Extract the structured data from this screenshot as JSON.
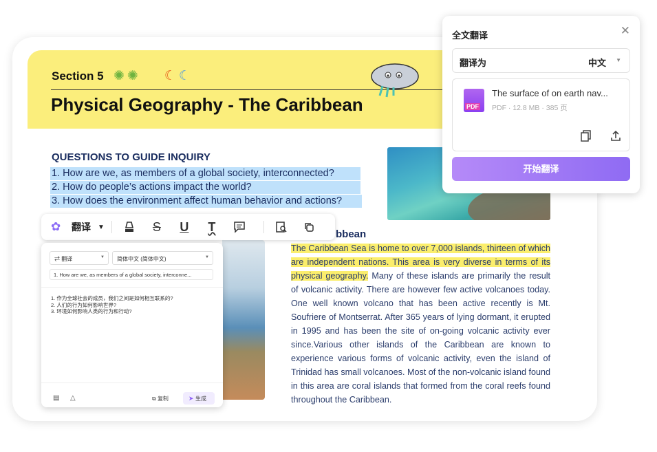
{
  "document": {
    "section": "Section 5",
    "title": "Physical Geography - The Caribbean",
    "questions_heading": "QUESTIONS TO GUIDE INQUIRY",
    "questions": [
      "1. How are we, as members of a global society, interconnected?",
      "2. How do people’s actions impact the world?",
      "3. How does the environment affect human behavior and actions?"
    ],
    "subheading_fragment": "bbean",
    "paragraph_highlighted": "The Caribbean Sea is home to over 7,000 islands, thirteen of which are independent nations. This area is very diverse in terms of its physical geography.",
    "paragraph_rest": " Many of these islands are primarily the result of volcanic activity. There are however few active volcanoes today. One well known volcano that has been active recently is Mt. Soufriere of Montserrat. After 365 years of lying dormant, it erupted in 1995 and has been the site of on-going volcanic activity ever since.Various other islands of the Caribbean are known to experience various forms of volcanic activity, even the island of Trinidad has small volcanoes. Most of the non-volcanic island found in this area are coral islands that formed from the coral reefs found throughout the Caribbean."
  },
  "toolbar": {
    "translate_label": "翻译",
    "icons": [
      "ai-logo-icon",
      "highlighter-icon",
      "strikethrough-icon",
      "underline-icon",
      "squiggly-text-icon",
      "comment-icon",
      "search-text-icon",
      "copy-icon"
    ]
  },
  "translate_panel": {
    "mode_label": "翻译",
    "target_language": "简体中文 (简体中文)",
    "source_text": "1. How are we, as members of a global society, interconne...",
    "result_lines": [
      "1. 作为全球社会的成员，我们之间是如何相互联系的?",
      "2. 人们的行为如何影响世界?",
      "3. 环境如何影响人类的行为和行动?"
    ],
    "copy_label": "复制",
    "generate_label": "生成"
  },
  "full_translate_panel": {
    "title": "全文翻译",
    "translate_to_label": "翻译为",
    "translate_to_value": "中文",
    "file_name": "The surface of  on earth nav...",
    "file_info": "PDF · 12.8 MB · 385 页",
    "pdf_badge": "PDF",
    "start_button": "开始翻译"
  },
  "colors": {
    "banner": "#fbee7c",
    "question_highlight": "#bfe1fb",
    "text_highlight": "#fbee6c",
    "accent": "#8f6bf3"
  }
}
